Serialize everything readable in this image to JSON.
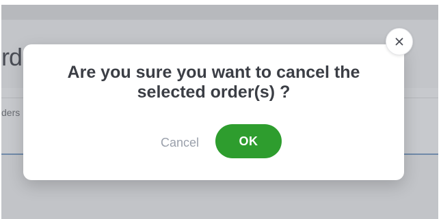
{
  "background": {
    "page_title_fragment": "rd",
    "tab_fragment": "ders"
  },
  "dialog": {
    "message_line1": "Are you sure you want to cancel the",
    "message_line2": "selected order(s) ?",
    "cancel_label": "Cancel",
    "ok_label": "OK",
    "close_icon": "close-icon"
  },
  "colors": {
    "ok_button": "#2e9d2e",
    "message_text": "#3b3e45",
    "cancel_text": "#9aa0ab",
    "overlay": "#c3c5c9"
  }
}
